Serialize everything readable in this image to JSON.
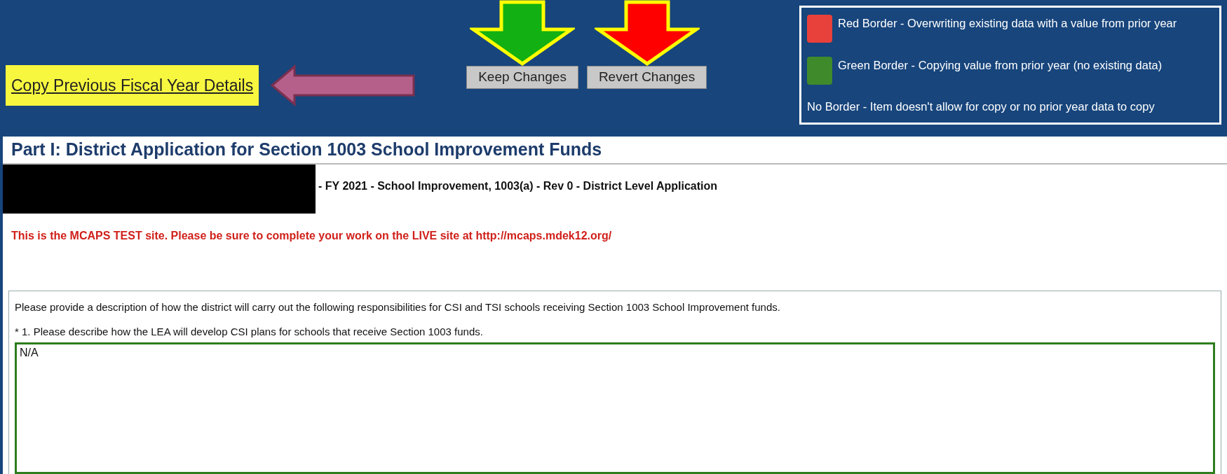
{
  "header": {
    "copy_link": "Copy Previous Fiscal Year Details",
    "buttons": [
      {
        "label": "Keep Changes",
        "color": "#12b012"
      },
      {
        "label": "Revert Changes",
        "color": "#ff0000"
      }
    ],
    "legend": [
      {
        "text": "Red Border - Overwriting existing data with a value from prior year",
        "color": "#e8403a"
      },
      {
        "text": "Green Border - Copying value from prior year (no existing data)",
        "color": "#3f8a2a"
      },
      {
        "text": "No Border - Item doesn't allow for copy or no prior year data to copy"
      }
    ]
  },
  "page_title": "Part I: District Application for Section 1003 School Improvement Funds",
  "application_line": "- FY 2021 - School Improvement, 1003(a) - Rev 0 - District Level Application",
  "test_notice": "This is the MCAPS TEST site. Please be sure to complete your work on the LIVE site at http://mcaps.mdek12.org/",
  "section": {
    "intro": "Please provide a description of how the district will carry out the following responsibilities for CSI and TSI schools receiving Section 1003 School Improvement funds.",
    "question": "* 1. Please describe how the LEA will develop CSI plans for schools that receive Section 1003 funds.",
    "answer": "N/A",
    "copied_from_prior_year": true
  }
}
